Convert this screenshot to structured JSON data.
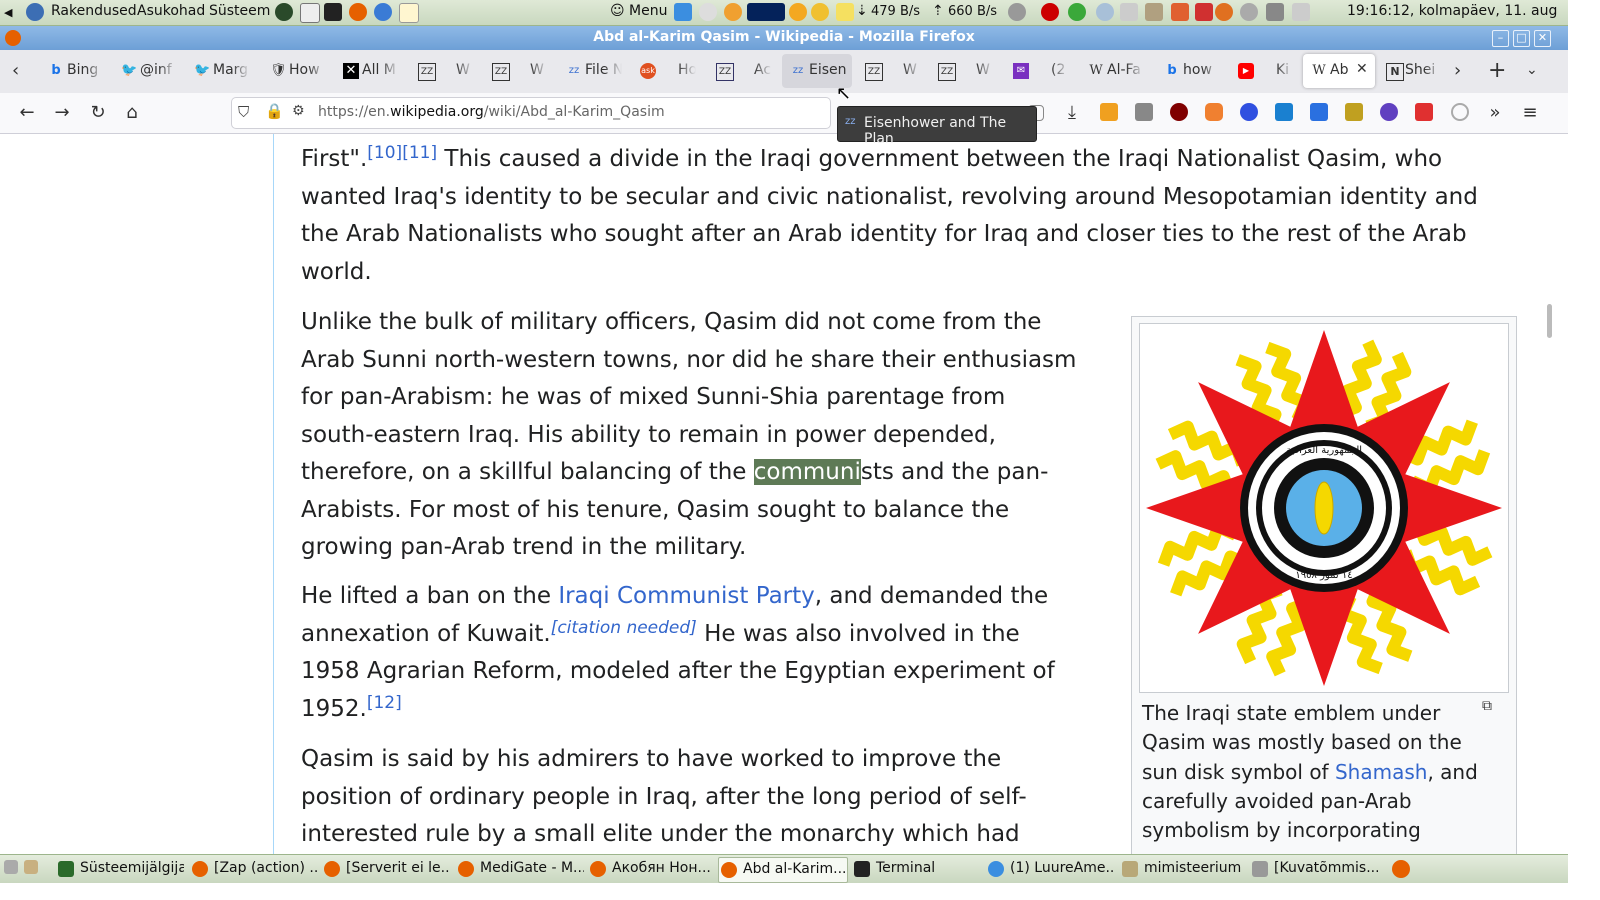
{
  "system_panel": {
    "menu_items": [
      "Rakendused",
      "Asukohad",
      "Süsteem"
    ],
    "menu_label": "Menu",
    "net_down": "479 B/s",
    "net_up": "660 B/s",
    "clock": "19:16:12, kolmapäev, 11. aug"
  },
  "window": {
    "title": "Abd al-Karim Qasim - Wikipedia - Mozilla Firefox"
  },
  "tabs": [
    {
      "label": "Bing",
      "icon": "bing-icon"
    },
    {
      "label": "@inf",
      "icon": "twitter-icon"
    },
    {
      "label": "Marg",
      "icon": "twitter-icon"
    },
    {
      "label": "How",
      "icon": "bookmark-icon"
    },
    {
      "label": "All M",
      "icon": "x-icon"
    },
    {
      "label": "W",
      "icon": "zz-icon"
    },
    {
      "label": "W",
      "icon": "zz-icon"
    },
    {
      "label": "File N",
      "icon": "zz-icon"
    },
    {
      "label": "Ho",
      "icon": "ask-icon"
    },
    {
      "label": "Ac",
      "icon": "zz-icon"
    },
    {
      "label": "Eisen",
      "icon": "zz-icon"
    },
    {
      "label": "W",
      "icon": "zz-icon"
    },
    {
      "label": "W",
      "icon": "zz-icon"
    },
    {
      "label": "(2",
      "icon": "mail-icon"
    },
    {
      "label": "Al-Fa",
      "icon": "wikipedia-icon"
    },
    {
      "label": "how",
      "icon": "bing-icon"
    },
    {
      "label": "Ki",
      "icon": "youtube-icon"
    },
    {
      "label": "Ab",
      "icon": "wikipedia-icon"
    },
    {
      "label": "Shei",
      "icon": "n-icon"
    }
  ],
  "address_bar": {
    "url_prefix": "https://en.",
    "url_domain": "wikipedia.org",
    "url_path": "/wiki/Abd_al-Karim_Qasim"
  },
  "tooltip": {
    "text": "Eisenhower and The Plan"
  },
  "article": {
    "p1": {
      "before": "First\".",
      "cite1": "[10]",
      "cite2": "[11]",
      "line1_after": " This caused a divide in the Iraqi government between the Iraqi Nationalist Qasim, who",
      "line2": "wanted Iraq's identity to be secular and civic nationalist, revolving around Mesopotamian identity and",
      "line3": "the Arab Nationalists who sought after an Arab identity for Iraq and closer ties to the rest of the Arab",
      "line4": "world."
    },
    "p2": {
      "l1": "Unlike the bulk of military officers, Qasim did not come from the",
      "l2": "Arab Sunni north-western towns, nor did he share their enthusiasm",
      "l3": "for pan-Arabism: he was of mixed Sunni-Shia parentage from",
      "l4": "south-eastern Iraq. His ability to remain in power depended,",
      "l5_before": "therefore, on a skillful balancing of the ",
      "l5_highlight": "communi",
      "l5_after": "sts and the pan-",
      "l6": "Arabists. For most of his tenure, Qasim sought to balance the",
      "l7": "growing pan-Arab trend in the military."
    },
    "p3": {
      "l1_before": "He lifted a ban on the ",
      "l1_link": "Iraqi Communist Party",
      "l1_after": ", and demanded the",
      "l2_before": "annexation of Kuwait.",
      "l2_cite": "[citation needed]",
      "l2_after": " He was also involved in the",
      "l3": "1958 Agrarian Reform, modeled after the Egyptian experiment of",
      "l4_before": "1952.",
      "l4_cite": "[12]"
    },
    "p4": {
      "l1": "Qasim is said by his admirers to have worked to improve the",
      "l2": "position of ordinary people in Iraq, after the long period of self-",
      "l3": "interested rule by a small elite under the monarchy which had"
    }
  },
  "infobox": {
    "emblem_text_top": "الجمهورية العراقية",
    "emblem_text_bottom": "١٤ تموز ١٩٥٨",
    "caption_l1": "The Iraqi state emblem under",
    "caption_l2": "Qasim was mostly based on the",
    "caption_l3_before": "sun disk symbol of ",
    "caption_l3_link": "Shamash",
    "caption_l3_after": ", and",
    "caption_l4": "carefully avoided pan-Arab",
    "caption_l5": "symbolism by incorporating"
  },
  "taskbar": {
    "items": [
      {
        "label": "Süsteemijälgija",
        "active": false
      },
      {
        "label": "[Zap (action) ...",
        "active": false
      },
      {
        "label": "[Serverit ei le...",
        "active": false
      },
      {
        "label": "MediGate - M...",
        "active": false
      },
      {
        "label": "Акобян Нон...",
        "active": false
      },
      {
        "label": "Abd al-Karim...",
        "active": true
      },
      {
        "label": "Terminal",
        "active": false
      },
      {
        "label": "(1) LuureAme...",
        "active": false
      },
      {
        "label": "mimisteerium",
        "active": false
      },
      {
        "label": "[Kuvatõmmis...",
        "active": false
      }
    ]
  },
  "colors": {
    "link": "#3366cc",
    "highlight": "#5e7a56",
    "titlebar": "#7aa7db"
  }
}
